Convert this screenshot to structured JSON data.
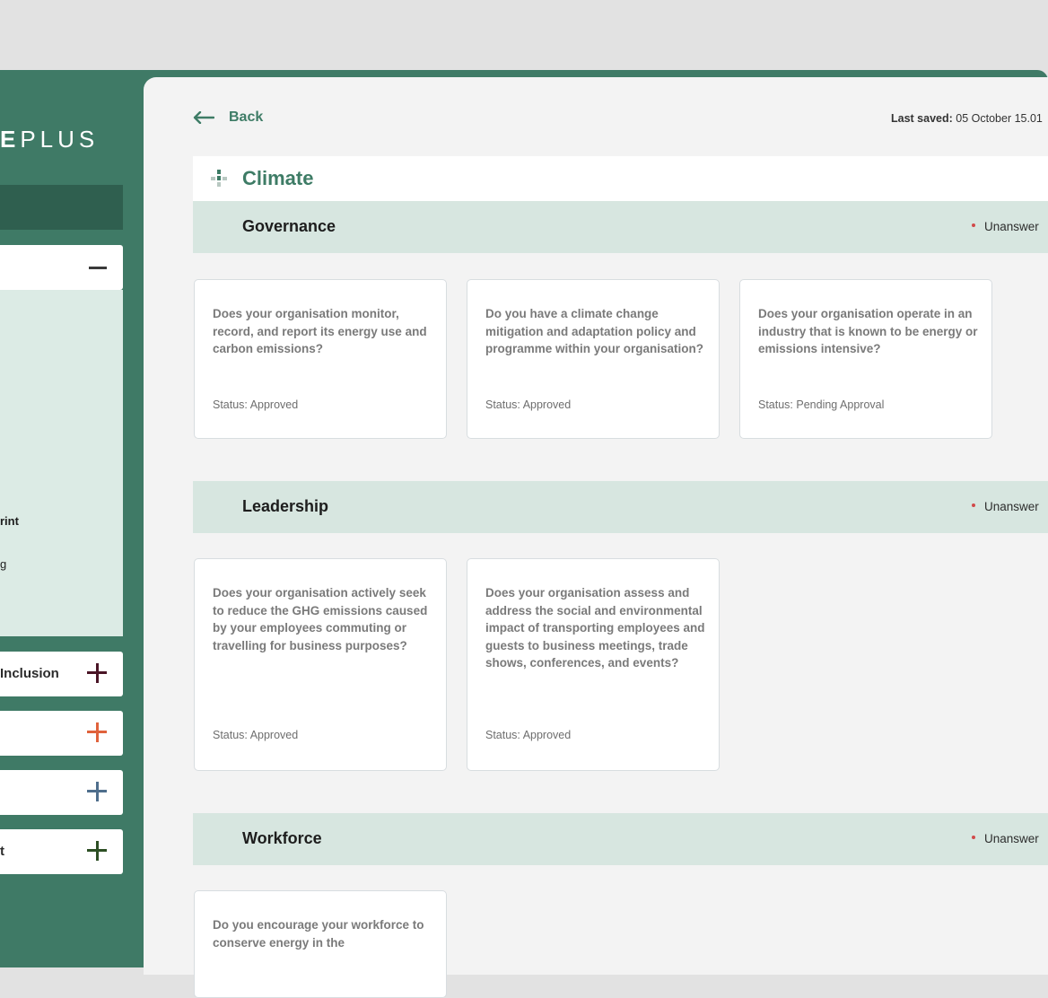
{
  "sidebar": {
    "brand_strong": "E",
    "brand_rest": "PLUS",
    "sub_items": [
      "rint",
      "g"
    ],
    "items": [
      {
        "label": "Inclusion",
        "plus_color": "#4a1526"
      },
      {
        "label": "",
        "plus_color": "#e0623c"
      },
      {
        "label": "",
        "plus_color": "#4f6e8c"
      },
      {
        "label": "t",
        "plus_color": "#2d4f24"
      }
    ]
  },
  "header": {
    "back_label": "Back",
    "last_saved_label": "Last saved:",
    "last_saved_value": "05 October 15.01"
  },
  "page": {
    "title": "Climate"
  },
  "sections": [
    {
      "name": "Governance",
      "state": "Unanswer",
      "cards": [
        {
          "question": "Does your organisation monitor, record, and report its energy use and carbon emissions?",
          "status": "Status: Approved"
        },
        {
          "question": "Do you have a climate change mitigation and adaptation policy and programme within your organisation?",
          "status": "Status: Approved"
        },
        {
          "question": "Does your organisation operate in an industry that is known to be energy or emissions intensive?",
          "status": "Status: Pending Approval"
        }
      ]
    },
    {
      "name": "Leadership",
      "state": "Unanswer",
      "cards": [
        {
          "question": "Does your organisation actively seek to reduce the GHG emissions caused by your employees commuting or travelling for business purposes?",
          "status": "Status: Approved"
        },
        {
          "question": "Does your organisation assess and address the social and environmental impact of transporting employees and guests to business meetings, trade shows, conferences, and events?",
          "status": "Status: Approved"
        }
      ]
    },
    {
      "name": "Workforce",
      "state": "Unanswer",
      "cards": [
        {
          "question": "Do you encourage your workforce to conserve energy in the",
          "status": ""
        }
      ]
    }
  ],
  "colors": {
    "accent": "#3e7c66",
    "sidebar_bg": "#3f7a66",
    "section_bg": "#d7e6e0",
    "unanswered_dot": "#d14a4a"
  }
}
